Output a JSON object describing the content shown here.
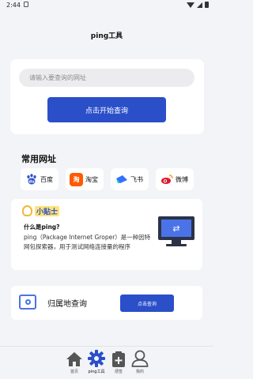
{
  "status_bar": {
    "time": "2:44"
  },
  "app": {
    "title": "ping工具"
  },
  "search": {
    "placeholder": "请输入要查询的网址",
    "button_label": "点击开始查询"
  },
  "common_sites": {
    "title": "常用网址",
    "items": [
      {
        "label": "百度",
        "icon": "baidu-icon",
        "color": "#2b4fc9"
      },
      {
        "label": "淘宝",
        "icon": "taobao-icon",
        "color": "#ff5a00"
      },
      {
        "label": "飞书",
        "icon": "feishu-icon",
        "color": "#3370ff"
      },
      {
        "label": "微博",
        "icon": "weibo-icon",
        "color": "#e6162d"
      }
    ]
  },
  "tip": {
    "badge": "小贴士",
    "question": "什么是ping?",
    "text": "ping（Package Internet Groper）是一种因特网包探索器，用于测试网络连接量的程序"
  },
  "geo": {
    "label": "归属地查询",
    "button_label": "点击查询"
  },
  "bottom_nav": {
    "items": [
      {
        "label": "首页",
        "icon": "home-icon"
      },
      {
        "label": "ping工具",
        "icon": "gear-icon"
      },
      {
        "label": "便签",
        "icon": "note-icon"
      },
      {
        "label": "我的",
        "icon": "user-icon"
      }
    ]
  },
  "colors": {
    "accent": "#2b4fc9",
    "background": "#f3f4f7"
  }
}
